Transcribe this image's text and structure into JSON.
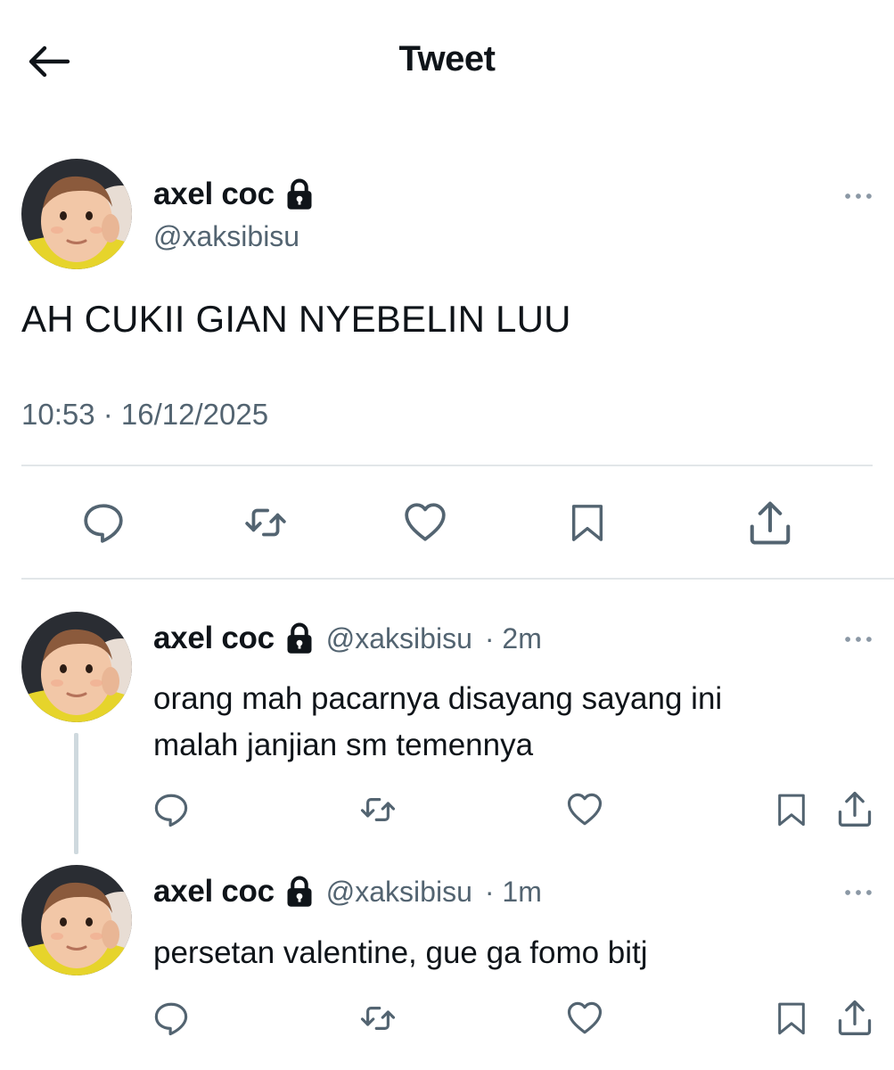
{
  "header": {
    "title": "Tweet",
    "back_icon": "arrow-left-icon"
  },
  "main_tweet": {
    "author": {
      "name": "axel coc",
      "handle": "@xaksibisu",
      "protected": true
    },
    "text": "AH CUKII GIAN NYEBELIN LUU",
    "timestamp": "10:53 · 16/12/2025",
    "actions": [
      "reply-icon",
      "retweet-icon",
      "like-icon",
      "bookmark-icon",
      "share-icon"
    ]
  },
  "replies": [
    {
      "author": {
        "name": "axel coc",
        "handle": "@xaksibisu",
        "protected": true
      },
      "time": "· 2m",
      "lines": [
        "orang mah pacarnya disayang sayang ini",
        "malah janjian sm temennya"
      ]
    },
    {
      "author": {
        "name": "axel coc",
        "handle": "@xaksibisu",
        "protected": true
      },
      "time": "· 1m",
      "lines": [
        "persetan valentine, gue ga fomo bitj"
      ]
    }
  ],
  "colors": {
    "text": "#0f1419",
    "secondary": "#536471",
    "divider": "#e2e6e9",
    "thread_line": "#cfd9de"
  }
}
